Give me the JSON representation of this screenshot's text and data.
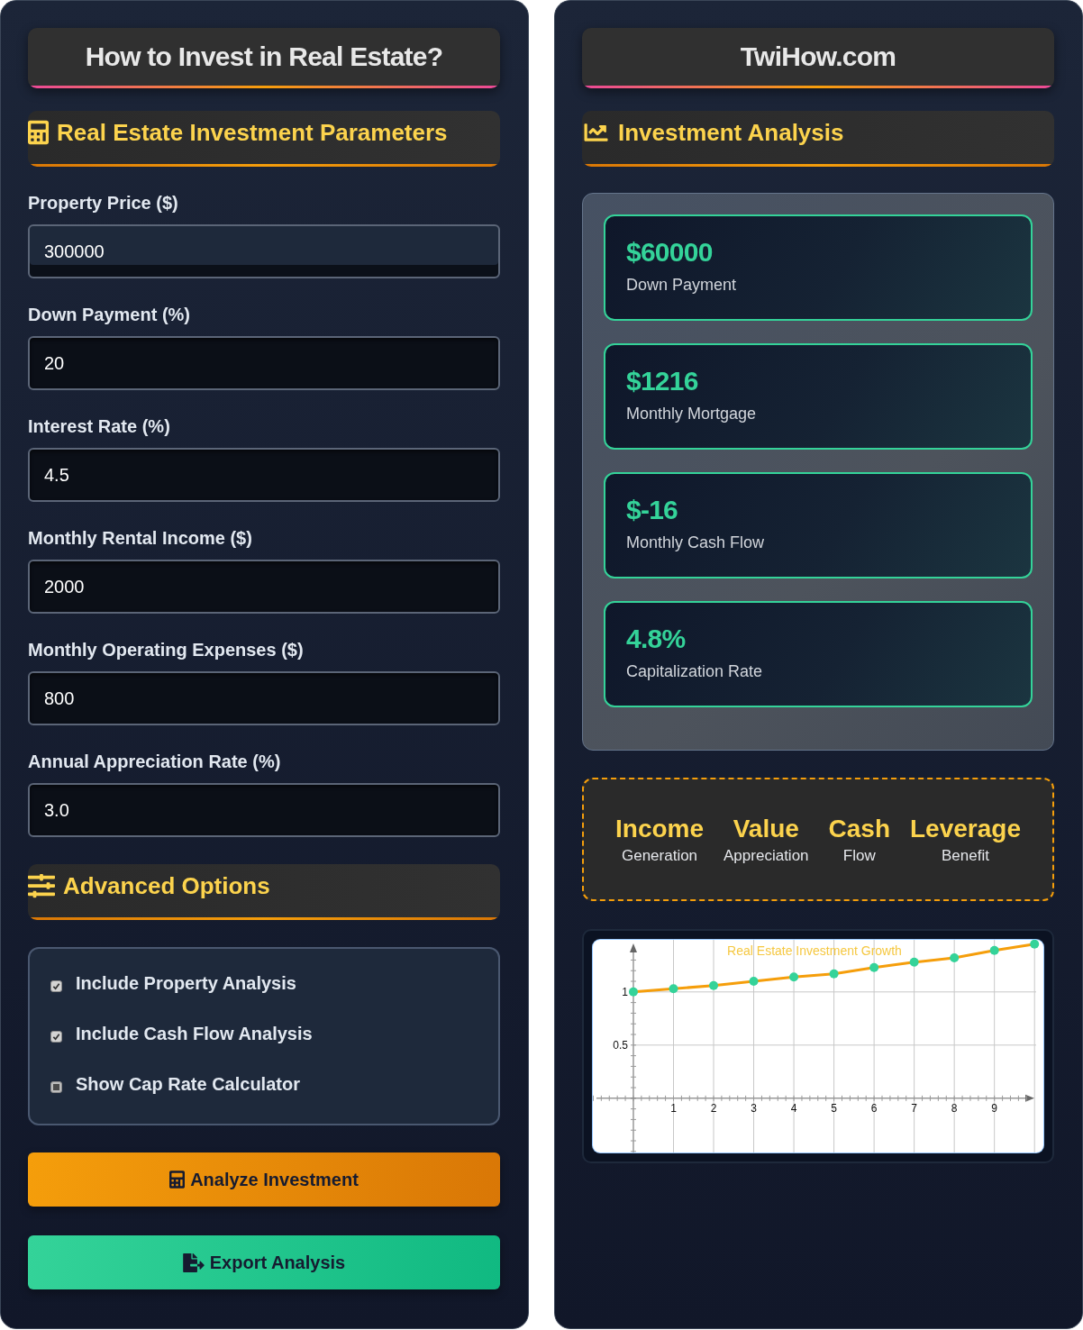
{
  "left_panel": {
    "title": "How to Invest in Real Estate?",
    "parameters_header": {
      "title": "Real Estate Investment Parameters"
    },
    "fields": [
      {
        "label": "Property Price ($)",
        "value": "300000",
        "focused": true
      },
      {
        "label": "Down Payment (%)",
        "value": "20",
        "focused": false
      },
      {
        "label": "Interest Rate (%)",
        "value": "4.5",
        "focused": false
      },
      {
        "label": "Monthly Rental Income ($)",
        "value": "2000",
        "focused": false
      },
      {
        "label": "Monthly Operating Expenses ($)",
        "value": "800",
        "focused": false
      },
      {
        "label": "Annual Appreciation Rate (%)",
        "value": "3.0",
        "focused": false
      }
    ],
    "advanced_header": {
      "title": "Advanced Options"
    },
    "options": [
      {
        "label": "Include Property Analysis",
        "checked": true
      },
      {
        "label": "Include Cash Flow Analysis",
        "checked": true
      },
      {
        "label": "Show Cap Rate Calculator",
        "checked": false
      }
    ],
    "buttons": [
      {
        "label": "Analyze Investment",
        "kind": "analyze"
      },
      {
        "label": "Export Analysis",
        "kind": "export"
      }
    ]
  },
  "right_panel": {
    "title": "TwiHow.com",
    "analysis_header": {
      "title": "Investment Analysis"
    },
    "metrics": [
      {
        "value": "$60000",
        "label": "Down Payment"
      },
      {
        "value": "$1216",
        "label": "Monthly Mortgage"
      },
      {
        "value": "$-16",
        "label": "Monthly Cash Flow"
      },
      {
        "value": "4.8%",
        "label": "Capitalization Rate"
      }
    ],
    "features": [
      {
        "title": "Income",
        "subtitle": "Generation"
      },
      {
        "title": "Value",
        "subtitle": "Appreciation"
      },
      {
        "title": "Cash",
        "subtitle": "Flow"
      },
      {
        "title": "Leverage",
        "subtitle": "Benefit"
      }
    ],
    "chart": {
      "chart_data": {
        "type": "line",
        "title": "Real Estate Investment Growth",
        "x": [
          0,
          1,
          2,
          3,
          4,
          5,
          6,
          7,
          8,
          9,
          10
        ],
        "series": [
          {
            "color": "#f59e0b",
            "values": [
              1,
              1.03,
              1.06,
              1.1,
              1.14,
              1.17,
              1.23,
              1.28,
              1.32,
              1.39,
              1.45
            ]
          }
        ],
        "xlim": [
          -1.01,
          10.22
        ],
        "ylim": [
          -0.51,
          1.49
        ],
        "xticks": [
          1,
          2,
          3,
          4,
          5,
          6,
          7,
          8,
          9
        ],
        "yticks": [
          0.5,
          1
        ],
        "grid": true,
        "marker": true
      }
    }
  }
}
